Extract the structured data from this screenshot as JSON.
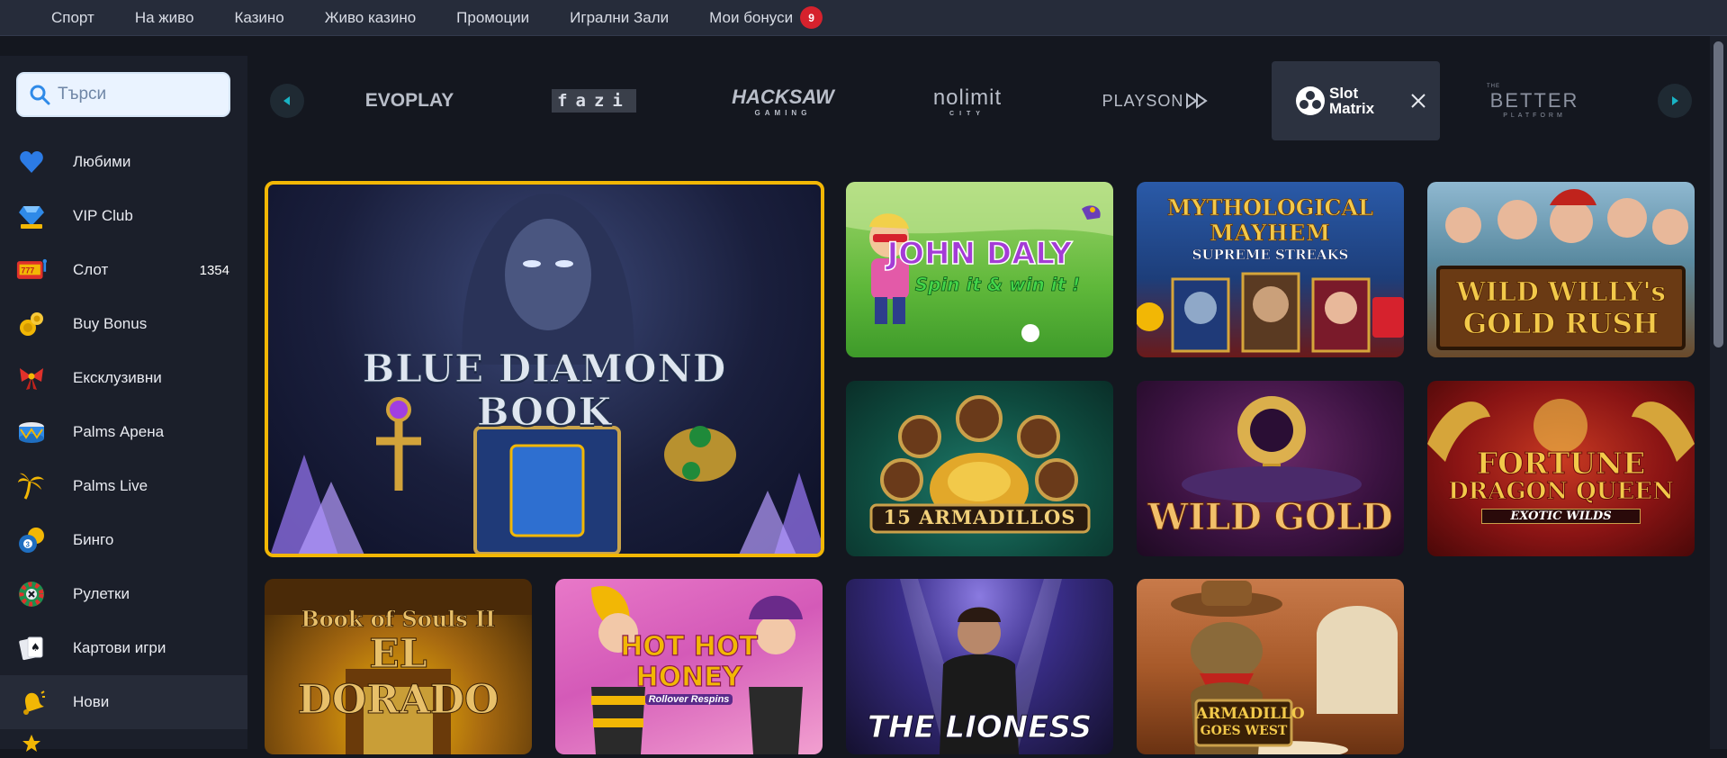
{
  "topnav": {
    "items": [
      "Спорт",
      "На живо",
      "Казино",
      "Живо казино",
      "Промоции",
      "Игрални Зали",
      "Мои бонуси"
    ],
    "bonus_badge": "9"
  },
  "search": {
    "placeholder": "Търси"
  },
  "sidebar": {
    "items": [
      {
        "label": "Любими",
        "icon": "heart-icon"
      },
      {
        "label": "VIP Club",
        "icon": "diamond-jackpot-icon"
      },
      {
        "label": "Слот",
        "icon": "slot-machine-icon",
        "count": "1354"
      },
      {
        "label": "Buy Bonus",
        "icon": "coins-icon"
      },
      {
        "label": "Ексклузивни",
        "icon": "gift-bow-icon"
      },
      {
        "label": "Palms Арена",
        "icon": "drum-icon"
      },
      {
        "label": "Palms Live",
        "icon": "palm-tree-icon"
      },
      {
        "label": "Бинго",
        "icon": "bingo-ball-icon"
      },
      {
        "label": "Рулетки",
        "icon": "roulette-icon"
      },
      {
        "label": "Картови игри",
        "icon": "cards-icon"
      },
      {
        "label": "Нови",
        "icon": "bell-icon"
      }
    ]
  },
  "providers": [
    {
      "name": "EVOPLAY"
    },
    {
      "name": "fazi"
    },
    {
      "name": "HACKSAW",
      "sub": "GAMING"
    },
    {
      "name": "nolimit",
      "sub": "CITY"
    },
    {
      "name": "PLAYSON"
    },
    {
      "name": "Slot Matrix"
    },
    {
      "name": "BETTER",
      "pre": "THE",
      "sub": "PLATFORM"
    }
  ],
  "games": [
    {
      "title_line1": "BLUE DIAMOND",
      "title_line2": "BOOK"
    },
    {
      "title_line1": "JOHN DALY",
      "title_line2": "Spin it & win it !"
    },
    {
      "title_line1": "MYTHOLOGICAL",
      "title_line2": "MAYHEM",
      "title_line3": "SUPREME STREAKS"
    },
    {
      "title_line1": "WILD WILLY's",
      "title_line2": "GOLD RUSH"
    },
    {
      "title_line1": "15 ARMADILLOS"
    },
    {
      "title_line1": "WILD GOLD"
    },
    {
      "title_line1": "FORTUNE",
      "title_line2": "DRAGON QUEEN",
      "title_line3": "EXOTIC WILDS"
    },
    {
      "title_line1": "Book of Souls II",
      "title_line2": "EL DORADO"
    },
    {
      "title_line1": "HOT HOT",
      "title_line2": "HONEY",
      "title_line3": "Rollover Respins"
    },
    {
      "title_line1": "THE LIONESS"
    },
    {
      "title_line1": "ARMADILLO",
      "title_line2": "GOES WEST"
    }
  ],
  "colors": {
    "accent": "#f2b705",
    "badge": "#d6222d",
    "nav_bg": "#262c3a",
    "sidebar_bg": "#1b1f2a",
    "page_bg": "#14171f",
    "arrow_accent": "#19b3c4"
  }
}
